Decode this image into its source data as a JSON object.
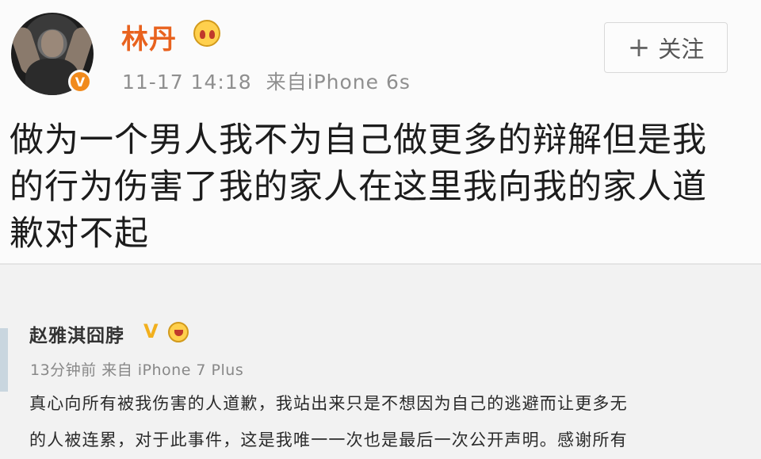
{
  "post1": {
    "username": "林丹",
    "time": "11-17 14:18",
    "source": "来自iPhone 6s",
    "follow_label": "关注",
    "follow_icon": "plus-icon",
    "avatar_badge": "V",
    "text_lines": [
      "做为一个男人我不为自己做更多的辩解但是我",
      "的行为伤害了我的家人在这里我向我的家人道",
      "歉对不起"
    ]
  },
  "post2": {
    "username": "赵雅淇囧脖",
    "verified_mark": "V",
    "meta": "13分钟前 来自 iPhone 7 Plus",
    "text_lines": [
      "真心向所有被我伤害的人道歉，我站出来只是不想因为自己的逃避而让更多无",
      "的人被连累，对于此事件，这是我唯一一次也是最后一次公开声明。感谢所有"
    ]
  },
  "colors": {
    "name_orange": "#e8621e",
    "badge_orange": "#f18a1c",
    "meta_gray": "#8f8f8f"
  }
}
